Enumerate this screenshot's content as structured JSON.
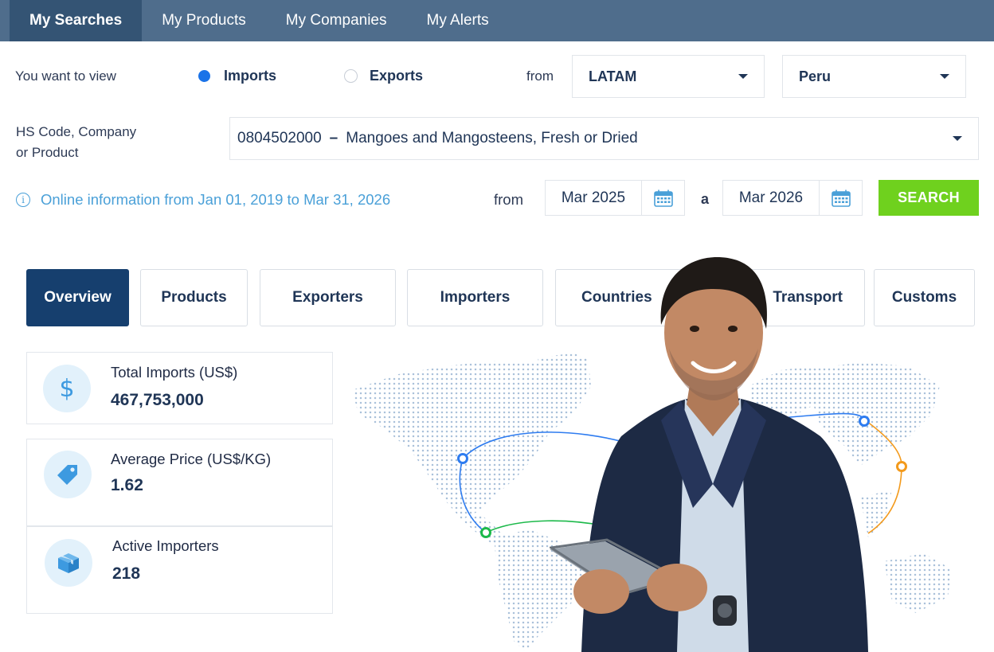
{
  "nav": {
    "tabs": [
      {
        "label": "My Searches",
        "active": true
      },
      {
        "label": "My Products",
        "active": false
      },
      {
        "label": "My Companies",
        "active": false
      },
      {
        "label": "My Alerts",
        "active": false
      }
    ]
  },
  "filters": {
    "view_label": "You want to view",
    "imports_label": "Imports",
    "exports_label": "Exports",
    "selected_view": "Imports",
    "from_label": "from",
    "region": "LATAM",
    "country": "Peru",
    "hs_label_line1": "HS Code, Company",
    "hs_label_line2": "or Product",
    "hs_code": "0804502000",
    "hs_separator": "–",
    "hs_description": "Mangoes and Mangosteens, Fresh or Dried",
    "info_text": "Online information from Jan 01, 2019 to Mar 31, 2026",
    "date_from_label": "from",
    "date_from": "Mar 2025",
    "date_to_label": "a",
    "date_to": "Mar 2026",
    "search_label": "SEARCH"
  },
  "section_tabs": [
    {
      "label": "Overview",
      "active": true
    },
    {
      "label": "Products",
      "active": false
    },
    {
      "label": "Exporters",
      "active": false
    },
    {
      "label": "Importers",
      "active": false
    },
    {
      "label": "Countries",
      "active": false
    },
    {
      "label": "Transport",
      "active": false
    },
    {
      "label": "Customs",
      "active": false
    }
  ],
  "stats": [
    {
      "title": "Total Imports (US$)",
      "value": "467,753,000",
      "icon": "dollar-icon"
    },
    {
      "title": "Average Price (US$/KG)",
      "value": "1.62",
      "icon": "price-tag-icon"
    },
    {
      "title": "Active Importers",
      "value": "218",
      "icon": "box-icon"
    }
  ],
  "colors": {
    "nav_bg": "#4f6d8c",
    "nav_active": "#345474",
    "accent_blue": "#1a73e8",
    "info_blue": "#4aa0d8",
    "search_green": "#6fd11e",
    "tab_active": "#163f6e"
  }
}
